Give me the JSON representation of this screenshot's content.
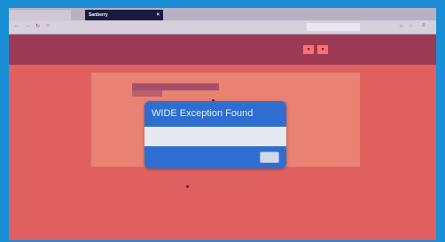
{
  "browser": {
    "tabs": [
      {
        "label": "",
        "active": false
      },
      {
        "label": "Sanberry",
        "active": true
      }
    ],
    "address": {
      "url": "",
      "search_placeholder": ""
    },
    "icons": [
      "back-icon",
      "forward-icon",
      "reload-icon",
      "home-icon",
      "menu-icon"
    ]
  },
  "site_header": {
    "link": ""
  },
  "content": {
    "menu_label": ""
  },
  "dialog": {
    "title": "WIDE Exception Found",
    "message": "",
    "button_label": ""
  },
  "colors": {
    "frame": "#1b8fd6",
    "page_background": "#e06060",
    "header": "#9b3a52",
    "dialog": "#2e6ed0"
  }
}
